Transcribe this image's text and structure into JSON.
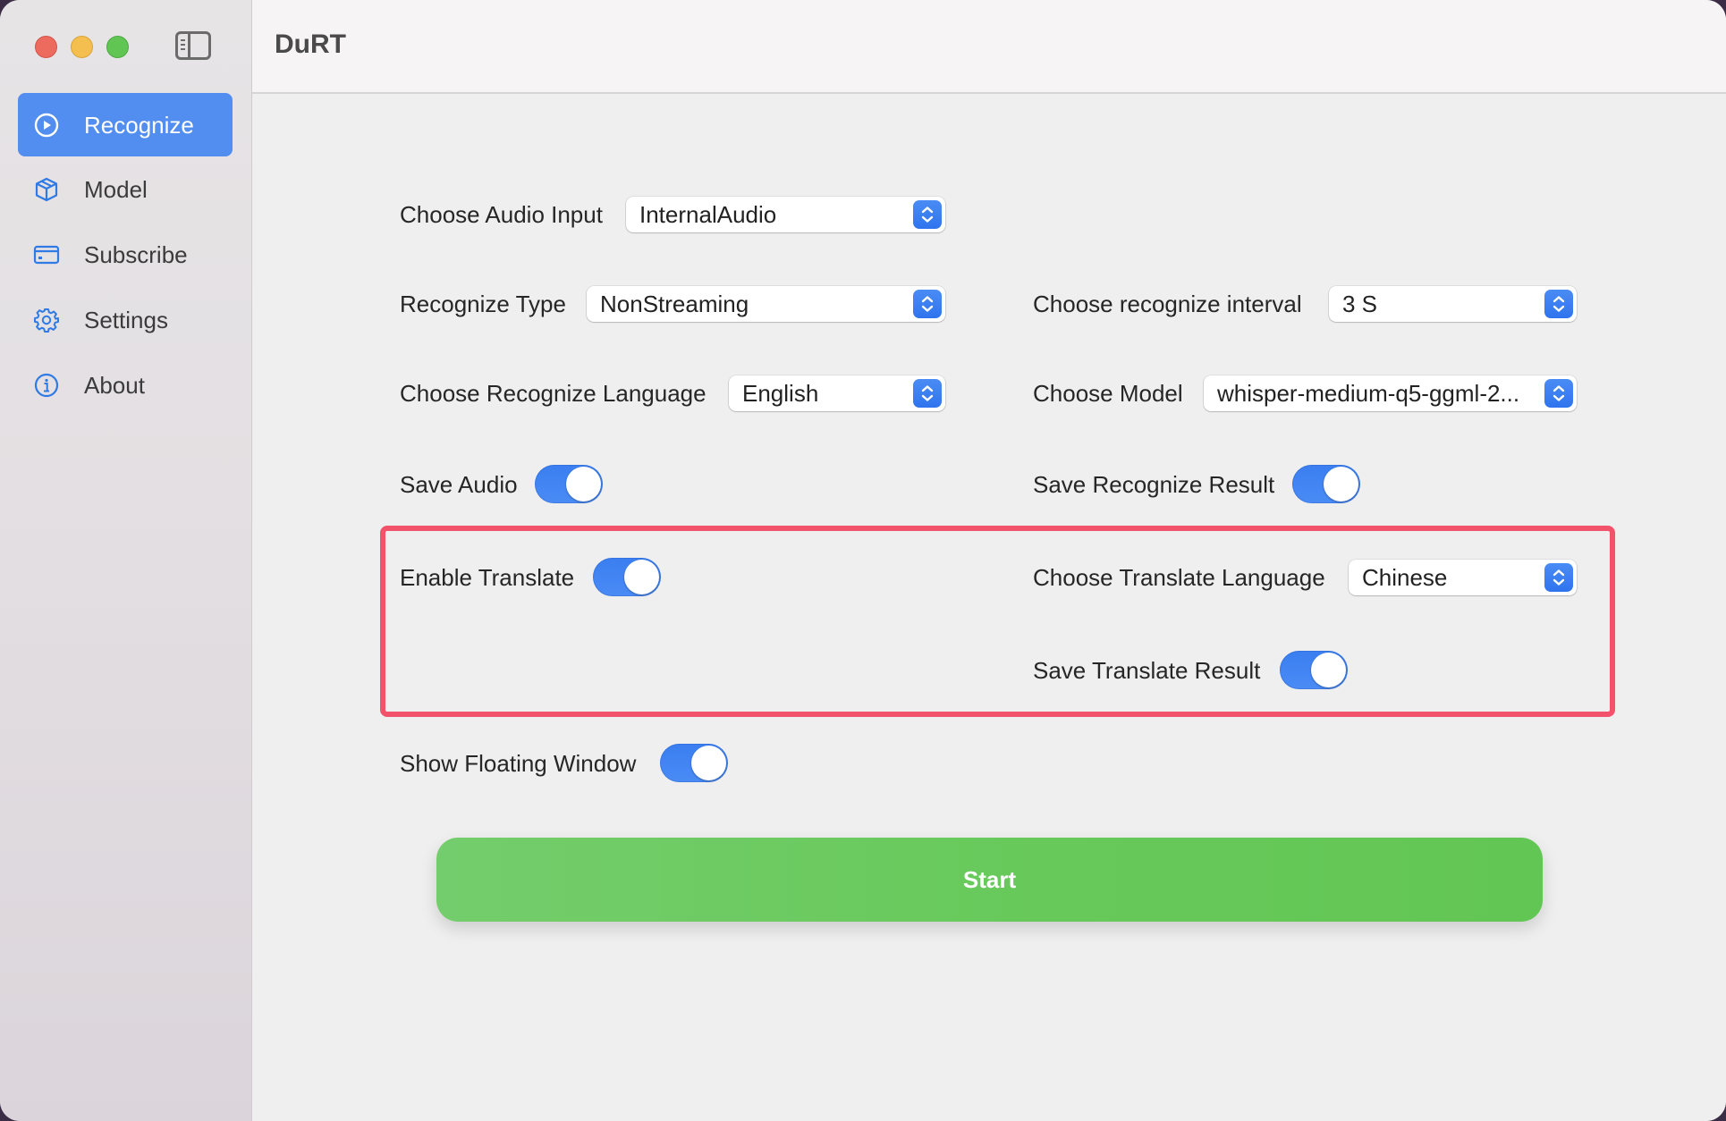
{
  "window": {
    "title": "DuRT",
    "traffic_lights": [
      "close",
      "minimize",
      "zoom"
    ]
  },
  "sidebar": {
    "toggle_icon": "sidebar-toggle-icon",
    "items": [
      {
        "label": "Recognize",
        "icon": "play-circle-icon",
        "selected": true
      },
      {
        "label": "Model",
        "icon": "cube-icon",
        "selected": false
      },
      {
        "label": "Subscribe",
        "icon": "credit-card-icon",
        "selected": false
      },
      {
        "label": "Settings",
        "icon": "gear-icon",
        "selected": false
      },
      {
        "label": "About",
        "icon": "info-circle-icon",
        "selected": false
      }
    ]
  },
  "form": {
    "audio_input": {
      "label": "Choose Audio Input",
      "value": "InternalAudio"
    },
    "recognize_type": {
      "label": "Recognize Type",
      "value": "NonStreaming"
    },
    "recognize_interval": {
      "label": "Choose recognize interval",
      "value": "3 S"
    },
    "recognize_language": {
      "label": "Choose Recognize Language",
      "value": "English"
    },
    "model": {
      "label": "Choose Model",
      "value": "whisper-medium-q5-ggml-2..."
    },
    "save_audio": {
      "label": "Save Audio",
      "on": true
    },
    "save_recognize_result": {
      "label": "Save Recognize Result",
      "on": true
    },
    "enable_translate": {
      "label": "Enable Translate",
      "on": true
    },
    "translate_language": {
      "label": "Choose Translate Language",
      "value": "Chinese"
    },
    "save_translate_result": {
      "label": "Save Translate Result",
      "on": true
    },
    "show_floating_window": {
      "label": "Show Floating Window",
      "on": true
    }
  },
  "start_button": {
    "label": "Start"
  },
  "colors": {
    "accent": "#528ef0",
    "toggle_on": "#3b7ff0",
    "start_green": "#67c95a",
    "highlight_red": "#f2536a"
  }
}
